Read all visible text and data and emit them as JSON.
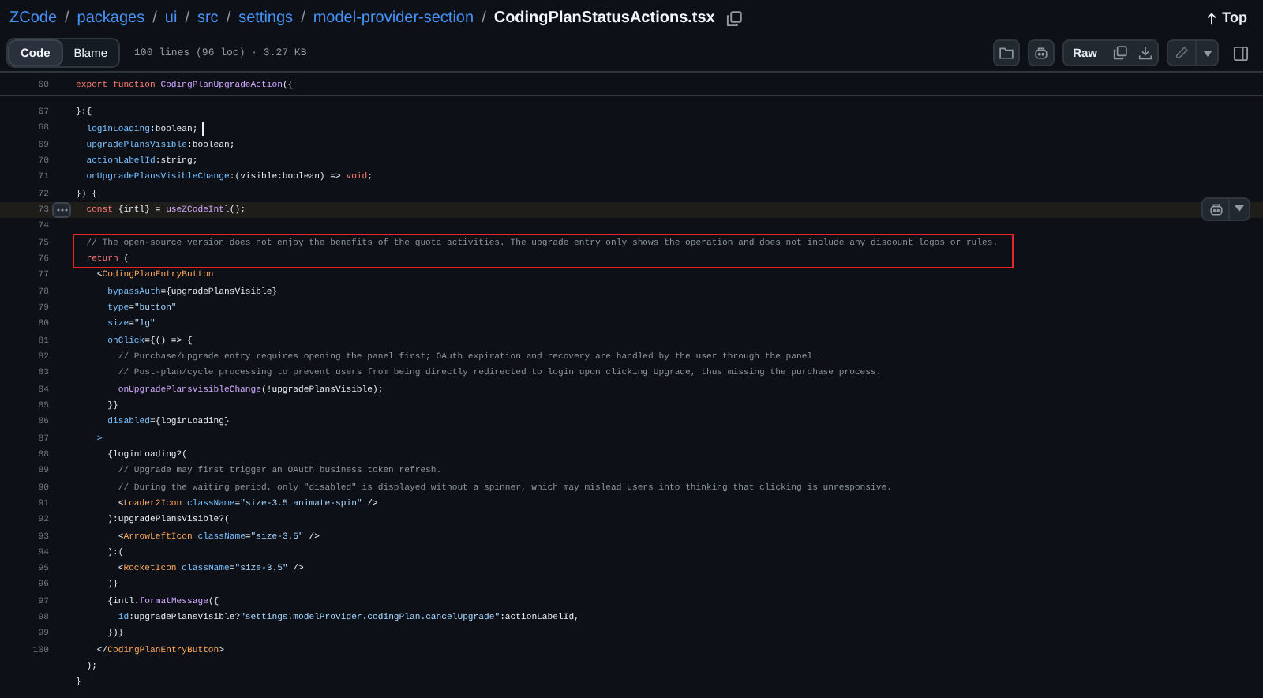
{
  "breadcrumb": [
    {
      "label": "ZCode",
      "kind": "link"
    },
    {
      "label": "packages",
      "kind": "link"
    },
    {
      "label": "ui",
      "kind": "link"
    },
    {
      "label": "src",
      "kind": "link"
    },
    {
      "label": "settings",
      "kind": "link"
    },
    {
      "label": "model-provider-section",
      "kind": "link"
    },
    {
      "label": "CodingPlanStatusActions.tsx",
      "kind": "current"
    }
  ],
  "separator": "/",
  "top_link": "Top",
  "view_tabs": [
    {
      "label": "Code",
      "selected": true
    },
    {
      "label": "Blame",
      "selected": false
    }
  ],
  "file_info": "100 lines (96 loc) · 3.27 KB",
  "raw_button": "Raw",
  "sticky_line": {
    "number": "60",
    "tokens": [
      {
        "kind": "keyword",
        "text": "export function "
      },
      {
        "kind": "function",
        "text": "CodingPlanUpgradeAction"
      },
      {
        "kind": "plain",
        "text": "({"
      }
    ]
  },
  "lines": [
    {
      "number": "67",
      "tokens": [
        {
          "kind": "plain",
          "text": "}:{"
        }
      ]
    },
    {
      "number": "68",
      "cursor": true,
      "tokens": [
        {
          "kind": "property",
          "text": "  loginLoading"
        },
        {
          "kind": "plain",
          "text": ":boolean;"
        }
      ]
    },
    {
      "number": "69",
      "tokens": [
        {
          "kind": "property",
          "text": "  upgradePlansVisible"
        },
        {
          "kind": "plain",
          "text": ":boolean;"
        }
      ]
    },
    {
      "number": "70",
      "tokens": [
        {
          "kind": "property",
          "text": "  actionLabelId"
        },
        {
          "kind": "plain",
          "text": ":string;"
        }
      ]
    },
    {
      "number": "71",
      "tokens": [
        {
          "kind": "property",
          "text": "  onUpgradePlansVisibleChange"
        },
        {
          "kind": "plain",
          "text": ":(visible:boolean) => "
        },
        {
          "kind": "keyword",
          "text": "void"
        },
        {
          "kind": "plain",
          "text": ";"
        }
      ]
    },
    {
      "number": "72",
      "tokens": [
        {
          "kind": "plain",
          "text": "}) {"
        }
      ]
    },
    {
      "number": "73",
      "highlighted": true,
      "tokens": [
        {
          "kind": "keyword",
          "text": "  const"
        },
        {
          "kind": "plain",
          "text": " {intl} = "
        },
        {
          "kind": "function",
          "text": "useZCodeIntl"
        },
        {
          "kind": "plain",
          "text": "();"
        }
      ]
    },
    {
      "number": "74"
    },
    {
      "number": "75",
      "boxed": true,
      "tokens": [
        {
          "kind": "comment",
          "text": "  // The open-source version does not enjoy the benefits of the quota activities. The upgrade entry only shows the operation and does not include any discount logos or rules."
        }
      ]
    },
    {
      "number": "76",
      "boxed": true,
      "tokens": [
        {
          "kind": "keyword",
          "text": "  return"
        },
        {
          "kind": "plain",
          "text": " ("
        }
      ]
    },
    {
      "number": "77",
      "tokens": [
        {
          "kind": "plain",
          "text": "    <"
        },
        {
          "kind": "tag",
          "text": "CodingPlanEntryButton"
        }
      ]
    },
    {
      "number": "78",
      "tokens": [
        {
          "kind": "property",
          "text": "      bypassAuth"
        },
        {
          "kind": "plain",
          "text": "={upgradePlansVisible}"
        }
      ]
    },
    {
      "number": "79",
      "tokens": [
        {
          "kind": "property",
          "text": "      type"
        },
        {
          "kind": "plain",
          "text": "="
        },
        {
          "kind": "string",
          "text": "\"button\""
        }
      ]
    },
    {
      "number": "80",
      "tokens": [
        {
          "kind": "property",
          "text": "      size"
        },
        {
          "kind": "plain",
          "text": "="
        },
        {
          "kind": "string",
          "text": "\"lg\""
        }
      ]
    },
    {
      "number": "81",
      "tokens": [
        {
          "kind": "property",
          "text": "      onClick"
        },
        {
          "kind": "plain",
          "text": "={() => {"
        }
      ]
    },
    {
      "number": "82",
      "tokens": [
        {
          "kind": "comment",
          "text": "        // Purchase/upgrade entry requires opening the panel first; OAuth expiration and recovery are handled by the user through the panel."
        }
      ]
    },
    {
      "number": "83",
      "tokens": [
        {
          "kind": "comment",
          "text": "        // Post-plan/cycle processing to prevent users from being directly redirected to login upon clicking Upgrade, thus missing the purchase process."
        }
      ]
    },
    {
      "number": "84",
      "tokens": [
        {
          "kind": "function",
          "text": "        onUpgradePlansVisibleChange"
        },
        {
          "kind": "plain",
          "text": "(!upgradePlansVisible);"
        }
      ]
    },
    {
      "number": "85",
      "tokens": [
        {
          "kind": "plain",
          "text": "      }}"
        }
      ]
    },
    {
      "number": "86",
      "tokens": [
        {
          "kind": "property",
          "text": "      disabled"
        },
        {
          "kind": "plain",
          "text": "={loginLoading}"
        }
      ]
    },
    {
      "number": "87",
      "tokens": [
        {
          "kind": "property",
          "text": "    >"
        }
      ]
    },
    {
      "number": "88",
      "tokens": [
        {
          "kind": "plain",
          "text": "      {loginLoading?("
        }
      ]
    },
    {
      "number": "89",
      "tokens": [
        {
          "kind": "comment",
          "text": "        // Upgrade may first trigger an OAuth business token refresh."
        }
      ]
    },
    {
      "number": "90",
      "tokens": [
        {
          "kind": "comment",
          "text": "        // During the waiting period, only \"disabled\" is displayed without a spinner, which may mislead users into thinking that clicking is unresponsive."
        }
      ]
    },
    {
      "number": "91",
      "tokens": [
        {
          "kind": "plain",
          "text": "        <"
        },
        {
          "kind": "tag",
          "text": "Loader2Icon"
        },
        {
          "kind": "property",
          "text": " className"
        },
        {
          "kind": "plain",
          "text": "="
        },
        {
          "kind": "string",
          "text": "\"size-3.5 animate-spin\""
        },
        {
          "kind": "plain",
          "text": " />"
        }
      ]
    },
    {
      "number": "92",
      "tokens": [
        {
          "kind": "plain",
          "text": "      ):upgradePlansVisible?("
        }
      ]
    },
    {
      "number": "93",
      "tokens": [
        {
          "kind": "plain",
          "text": "        <"
        },
        {
          "kind": "tag",
          "text": "ArrowLeftIcon"
        },
        {
          "kind": "property",
          "text": " className"
        },
        {
          "kind": "plain",
          "text": "="
        },
        {
          "kind": "string",
          "text": "\"size-3.5\""
        },
        {
          "kind": "plain",
          "text": " />"
        }
      ]
    },
    {
      "number": "94",
      "tokens": [
        {
          "kind": "plain",
          "text": "      ):("
        }
      ]
    },
    {
      "number": "95",
      "tokens": [
        {
          "kind": "plain",
          "text": "        <"
        },
        {
          "kind": "tag",
          "text": "RocketIcon"
        },
        {
          "kind": "property",
          "text": " className"
        },
        {
          "kind": "plain",
          "text": "="
        },
        {
          "kind": "string",
          "text": "\"size-3.5\""
        },
        {
          "kind": "plain",
          "text": " />"
        }
      ]
    },
    {
      "number": "96",
      "tokens": [
        {
          "kind": "plain",
          "text": "      )}"
        }
      ]
    },
    {
      "number": "97",
      "tokens": [
        {
          "kind": "plain",
          "text": "      {intl."
        },
        {
          "kind": "function",
          "text": "formatMessage"
        },
        {
          "kind": "plain",
          "text": "({"
        }
      ]
    },
    {
      "number": "98",
      "tokens": [
        {
          "kind": "property",
          "text": "        id"
        },
        {
          "kind": "plain",
          "text": ":upgradePlansVisible?"
        },
        {
          "kind": "string",
          "text": "\"settings.modelProvider.codingPlan.cancelUpgrade\""
        },
        {
          "kind": "plain",
          "text": ":actionLabelId,"
        }
      ]
    },
    {
      "number": "99",
      "tokens": [
        {
          "kind": "plain",
          "text": "      })}"
        }
      ]
    },
    {
      "number": "100",
      "tokens": [
        {
          "kind": "plain",
          "text": "    </"
        },
        {
          "kind": "tag",
          "text": "CodingPlanEntryButton"
        },
        {
          "kind": "plain",
          "text": ">"
        }
      ]
    },
    {
      "tokens": [
        {
          "kind": "plain",
          "text": "  );"
        }
      ]
    },
    {
      "tokens": [
        {
          "kind": "plain",
          "text": "}"
        }
      ]
    }
  ]
}
